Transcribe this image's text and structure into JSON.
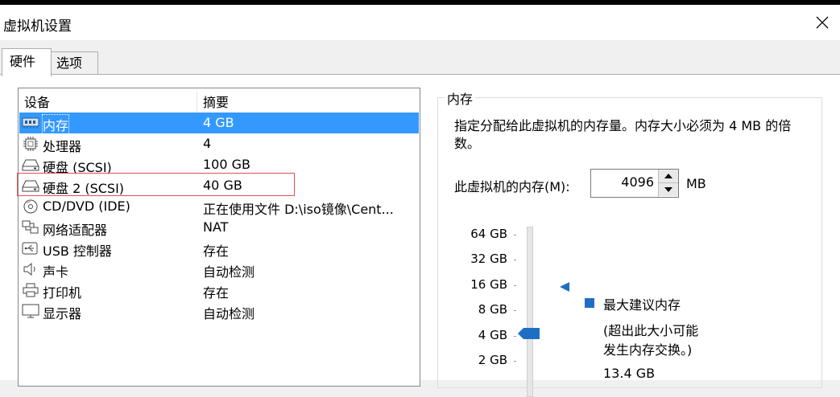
{
  "window": {
    "title": "虚拟机设置"
  },
  "tabs": [
    {
      "label": "硬件",
      "active": true
    },
    {
      "label": "选项",
      "active": false
    }
  ],
  "device_list": {
    "columns": [
      "设备",
      "摘要"
    ],
    "rows": [
      {
        "icon": "memory-icon",
        "device": "内存",
        "summary": "4 GB",
        "selected": true
      },
      {
        "icon": "processor-icon",
        "device": "处理器",
        "summary": "4"
      },
      {
        "icon": "hard-disk-icon",
        "device": "硬盘 (SCSI)",
        "summary": "100 GB"
      },
      {
        "icon": "hard-disk-icon",
        "device": "硬盘 2 (SCSI)",
        "summary": "40 GB",
        "highlighted": true
      },
      {
        "icon": "cd-dvd-icon",
        "device": "CD/DVD (IDE)",
        "summary": "正在使用文件 D:\\iso镜像\\Cent..."
      },
      {
        "icon": "network-adapter-icon",
        "device": "网络适配器",
        "summary": "NAT"
      },
      {
        "icon": "usb-icon",
        "device": "USB 控制器",
        "summary": "存在"
      },
      {
        "icon": "sound-card-icon",
        "device": "声卡",
        "summary": "自动检测"
      },
      {
        "icon": "printer-icon",
        "device": "打印机",
        "summary": "存在"
      },
      {
        "icon": "display-icon",
        "device": "显示器",
        "summary": "自动检测"
      }
    ]
  },
  "memory": {
    "group_title": "内存",
    "description": "指定分配给此虚拟机的内存量。内存大小必须为 4 MB 的倍数。",
    "field_label": "此虚拟机的内存(M):",
    "field_value": "4096",
    "unit": "MB",
    "scale_labels": [
      "64 GB",
      "32 GB",
      "16 GB",
      "8 GB",
      "4 GB",
      "2 GB"
    ],
    "recommended_label": "最大建议内存",
    "recommended_note_line1": "(超出此大小可能",
    "recommended_note_line2": "发生内存交换。)",
    "recommended_value": "13.4 GB"
  },
  "colors": {
    "selection": "#3399ff",
    "legend_marker": "#1e6fc4",
    "highlight_box": "#e05050"
  }
}
